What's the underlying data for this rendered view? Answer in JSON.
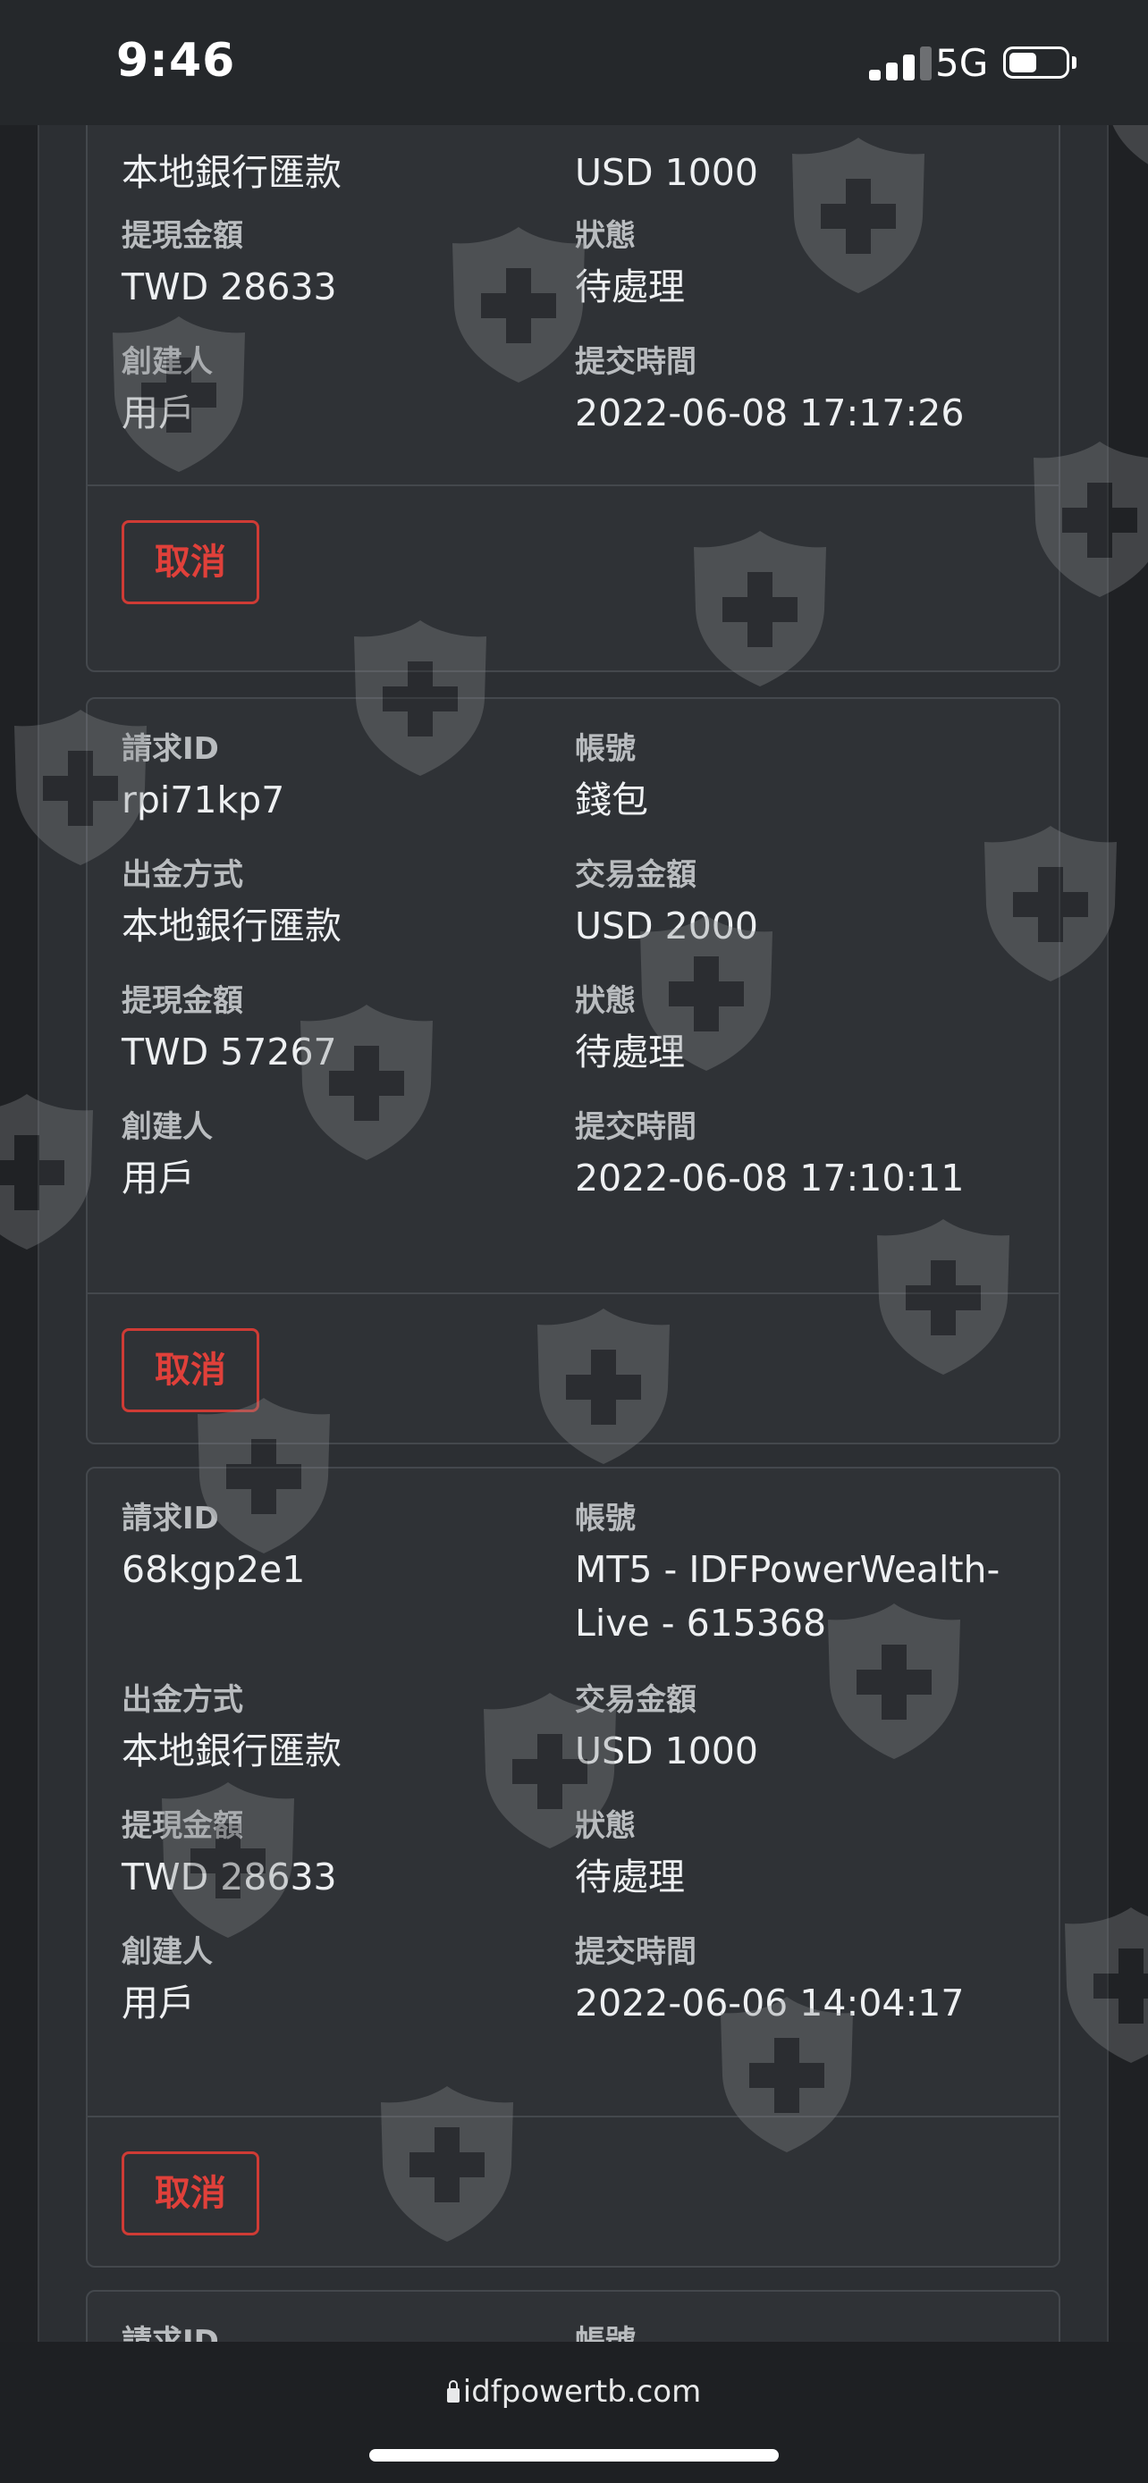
{
  "status_bar": {
    "time": "9:46",
    "network": "5G"
  },
  "labels": {
    "request_id": "請求ID",
    "account": "帳號",
    "method": "出金方式",
    "trade_amount": "交易金額",
    "withdraw_amount": "提現金額",
    "status": "狀態",
    "creator": "創建人",
    "submit_time": "提交時間",
    "cancel": "取消"
  },
  "cards": [
    {
      "method": "本地銀行匯款",
      "trade_amount": "USD 1000",
      "withdraw_amount": "TWD 28633",
      "status": "待處理",
      "creator": "用戶",
      "submit_time": "2022-06-08 17:17:26"
    },
    {
      "request_id": "rpi71kp7",
      "account": "錢包",
      "method": "本地銀行匯款",
      "trade_amount": "USD 2000",
      "withdraw_amount": "TWD 57267",
      "status": "待處理",
      "creator": "用戶",
      "submit_time": "2022-06-08 17:10:11"
    },
    {
      "request_id": "68kgp2e1",
      "account_line1": "MT5 - IDFPowerWealth-",
      "account_line2": "Live - 615368",
      "method": "本地銀行匯款",
      "trade_amount": "USD 1000",
      "withdraw_amount": "TWD 28633",
      "status": "待處理",
      "creator": "用戶",
      "submit_time": "2022-06-06 14:04:17"
    }
  ],
  "partial_card": {
    "request_id_label": "請求ID",
    "account_label": "帳號"
  },
  "browser": {
    "url": "idfpowertb.com"
  },
  "watermark_icon": "shield-plus-icon"
}
